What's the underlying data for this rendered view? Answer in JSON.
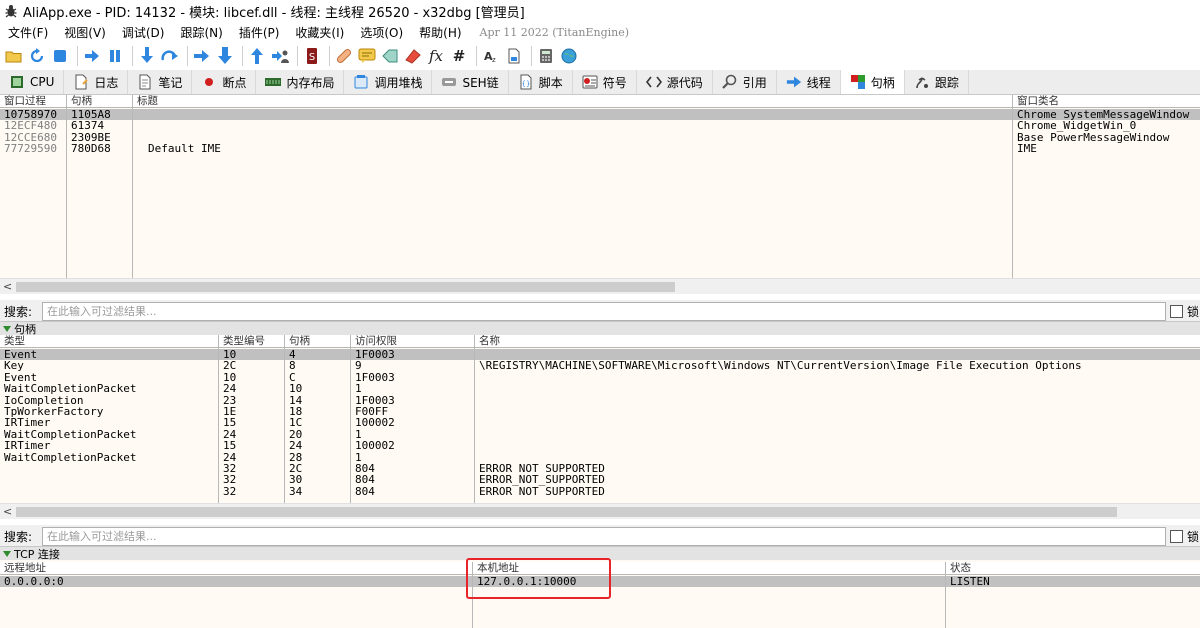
{
  "window": {
    "title": "AliApp.exe - PID: 14132 - 模块: libcef.dll - 线程: 主线程 26520 - x32dbg [管理员]"
  },
  "menu": {
    "items": [
      "文件(F)",
      "视图(V)",
      "调试(D)",
      "跟踪(N)",
      "插件(P)",
      "收藏夹(I)",
      "选项(O)",
      "帮助(H)"
    ],
    "build_info": "Apr 11 2022 (TitanEngine)"
  },
  "toolbar": {
    "fx_label": "fx",
    "hash_label": "#",
    "icons": [
      "open-icon",
      "restart-icon",
      "stop-icon",
      "run-icon",
      "pause-icon",
      "step-into-icon",
      "step-over-icon",
      "trace-into-icon",
      "trace-over-icon",
      "execute-till-return-icon",
      "run-to-user-code-icon",
      "scylla-icon",
      "patch-icon",
      "comment-icon",
      "label-icon",
      "bookmark-icon",
      "function-icon",
      "hash-icon",
      "font-icon",
      "file-icon",
      "calculator-icon",
      "globe-icon"
    ]
  },
  "tabs": [
    {
      "label": "CPU",
      "icon": "cpu-icon"
    },
    {
      "label": "日志",
      "icon": "log-icon"
    },
    {
      "label": "笔记",
      "icon": "notes-icon"
    },
    {
      "label": "断点",
      "icon": "breakpoint-icon"
    },
    {
      "label": "内存布局",
      "icon": "memory-map-icon"
    },
    {
      "label": "调用堆栈",
      "icon": "call-stack-icon"
    },
    {
      "label": "SEH链",
      "icon": "seh-icon"
    },
    {
      "label": "脚本",
      "icon": "script-icon"
    },
    {
      "label": "符号",
      "icon": "symbols-icon"
    },
    {
      "label": "源代码",
      "icon": "source-icon"
    },
    {
      "label": "引用",
      "icon": "references-icon"
    },
    {
      "label": "线程",
      "icon": "threads-icon"
    },
    {
      "label": "句柄",
      "icon": "handles-icon",
      "active": true
    },
    {
      "label": "跟踪",
      "icon": "trace-icon"
    }
  ],
  "windows_table": {
    "headers": [
      "窗口过程",
      "句柄",
      "标题",
      "窗口类名"
    ],
    "rows": [
      {
        "proc": "10758970",
        "handle": "1105A8",
        "title": "",
        "class": "Chrome_SystemMessageWindow",
        "selected": true
      },
      {
        "proc": "12ECF480",
        "handle": "61374",
        "title": "",
        "class": "Chrome_WidgetWin_0",
        "dim": true
      },
      {
        "proc": "12CCE680",
        "handle": "2309BE",
        "title": "",
        "class": "Base_PowerMessageWindow",
        "dim": true
      },
      {
        "proc": "77729590",
        "handle": "780D68",
        "title": "Default IME",
        "class": "IME",
        "dim": true
      }
    ]
  },
  "search": {
    "label": "搜索:",
    "placeholder": "在此输入可过滤结果...",
    "lock_label": "锁"
  },
  "handles_section": {
    "title": "句柄",
    "headers": [
      "类型",
      "类型编号",
      "句柄",
      "访问权限",
      "名称"
    ],
    "rows": [
      {
        "type": "Event",
        "typeno": "10",
        "handle": "4",
        "access": "1F0003",
        "name": "",
        "selected": true
      },
      {
        "type": "Key",
        "typeno": "2C",
        "handle": "8",
        "access": "9",
        "name": "\\REGISTRY\\MACHINE\\SOFTWARE\\Microsoft\\Windows NT\\CurrentVersion\\Image File Execution Options"
      },
      {
        "type": "Event",
        "typeno": "10",
        "handle": "C",
        "access": "1F0003",
        "name": ""
      },
      {
        "type": "WaitCompletionPacket",
        "typeno": "24",
        "handle": "10",
        "access": "1",
        "name": ""
      },
      {
        "type": "IoCompletion",
        "typeno": "23",
        "handle": "14",
        "access": "1F0003",
        "name": ""
      },
      {
        "type": "TpWorkerFactory",
        "typeno": "1E",
        "handle": "18",
        "access": "F00FF",
        "name": ""
      },
      {
        "type": "IRTimer",
        "typeno": "15",
        "handle": "1C",
        "access": "100002",
        "name": ""
      },
      {
        "type": "WaitCompletionPacket",
        "typeno": "24",
        "handle": "20",
        "access": "1",
        "name": ""
      },
      {
        "type": "IRTimer",
        "typeno": "15",
        "handle": "24",
        "access": "100002",
        "name": ""
      },
      {
        "type": "WaitCompletionPacket",
        "typeno": "24",
        "handle": "28",
        "access": "1",
        "name": ""
      },
      {
        "type": "",
        "typeno": "32",
        "handle": "2C",
        "access": "804",
        "name": "ERROR_NOT_SUPPORTED"
      },
      {
        "type": "",
        "typeno": "32",
        "handle": "30",
        "access": "804",
        "name": "ERROR_NOT_SUPPORTED"
      },
      {
        "type": "",
        "typeno": "32",
        "handle": "34",
        "access": "804",
        "name": "ERROR_NOT_SUPPORTED"
      }
    ]
  },
  "tcp_section": {
    "title": "TCP 连接",
    "headers": [
      "远程地址",
      "本机地址",
      "状态"
    ],
    "rows": [
      {
        "remote": "0.0.0.0:0",
        "local": "127.0.0.1:10000",
        "state": "LISTEN"
      }
    ]
  },
  "colors": {
    "grid_bg": "#fffaf3",
    "selected_row": "#c0c0c0",
    "highlight_box": "#e8232a",
    "section_arrow": "#2e8b2e"
  }
}
